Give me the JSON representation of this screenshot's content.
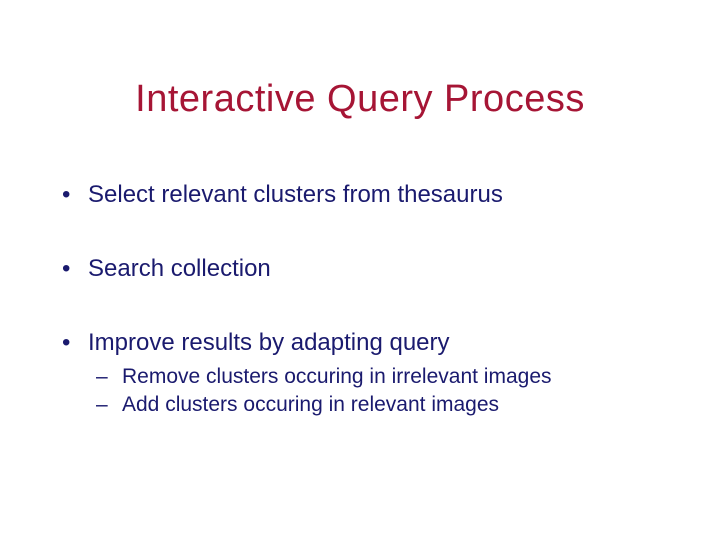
{
  "title": "Interactive Query Process",
  "bullets": [
    {
      "text": "Select relevant clusters from thesaurus",
      "sub": []
    },
    {
      "text": "Search collection",
      "sub": []
    },
    {
      "text": "Improve results by adapting query",
      "sub": [
        "Remove clusters occuring in irrelevant images",
        "Add clusters occuring in relevant images"
      ]
    }
  ]
}
